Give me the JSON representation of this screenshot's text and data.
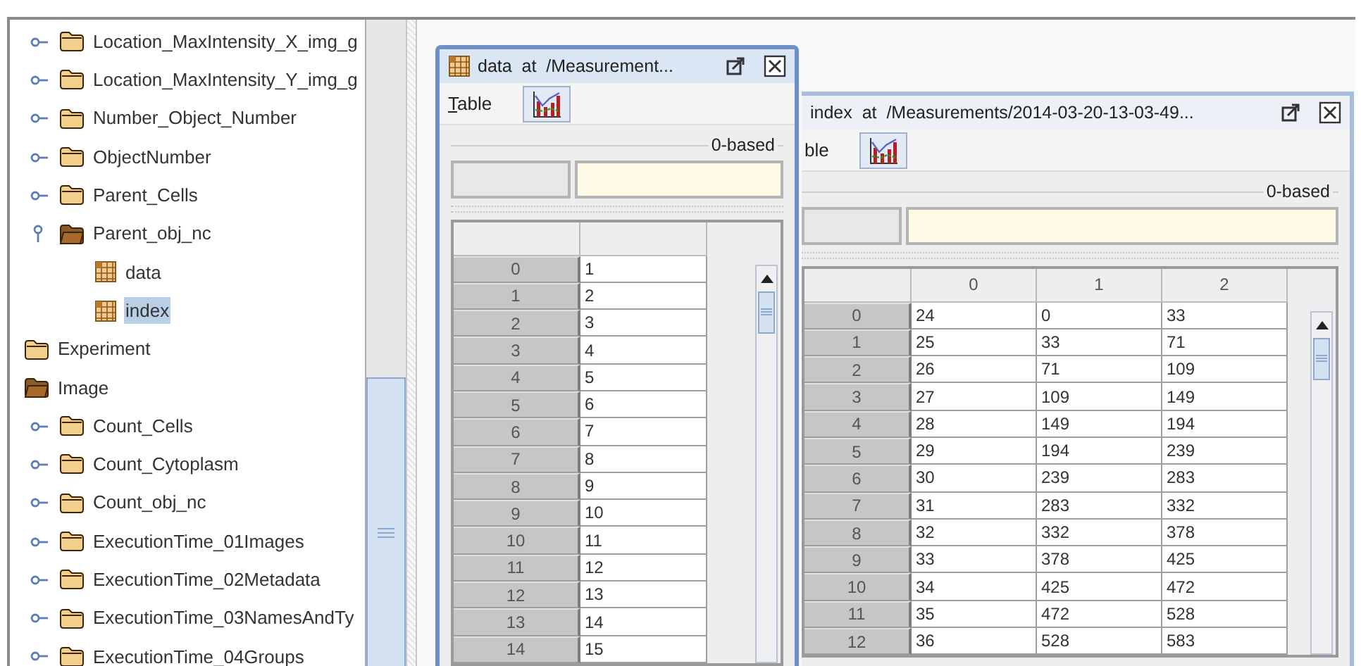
{
  "tree": {
    "items": [
      {
        "children": [
          {
            "label": "Location_MaxIntensity_X_img_g",
            "kind": "group",
            "expanded": false
          },
          {
            "label": "Location_MaxIntensity_Y_img_g",
            "kind": "group",
            "expanded": false
          },
          {
            "label": "Number_Object_Number",
            "kind": "group",
            "expanded": false
          },
          {
            "label": "ObjectNumber",
            "kind": "group",
            "expanded": false
          },
          {
            "label": "Parent_Cells",
            "kind": "group",
            "expanded": false
          },
          {
            "label": "Parent_obj_nc",
            "kind": "group",
            "expanded": true,
            "children": [
              {
                "label": "data",
                "kind": "dataset",
                "selected": false
              },
              {
                "label": "index",
                "kind": "dataset",
                "selected": true
              }
            ]
          }
        ]
      },
      {
        "label": "Experiment",
        "kind": "group",
        "expanded": false
      },
      {
        "label": "Image",
        "kind": "group",
        "expanded": true,
        "children": [
          {
            "label": "Count_Cells",
            "kind": "group",
            "expanded": false
          },
          {
            "label": "Count_Cytoplasm",
            "kind": "group",
            "expanded": false
          },
          {
            "label": "Count_obj_nc",
            "kind": "group",
            "expanded": false
          },
          {
            "label": "ExecutionTime_01Images",
            "kind": "group",
            "expanded": false
          },
          {
            "label": "ExecutionTime_02Metadata",
            "kind": "group",
            "expanded": false
          },
          {
            "label": "ExecutionTime_03NamesAndTy",
            "kind": "group",
            "expanded": false
          },
          {
            "label": "ExecutionTime_04Groups",
            "kind": "group",
            "expanded": false
          }
        ]
      }
    ]
  },
  "windows": [
    {
      "title": "data  at  /Measurement...",
      "active": true,
      "menu": "Table",
      "base_label": "0-based",
      "rows": [
        {
          "header": "0",
          "cells": [
            "1"
          ]
        },
        {
          "header": "1",
          "cells": [
            "2"
          ]
        },
        {
          "header": "2",
          "cells": [
            "3"
          ]
        },
        {
          "header": "3",
          "cells": [
            "4"
          ]
        },
        {
          "header": "4",
          "cells": [
            "5"
          ]
        },
        {
          "header": "5",
          "cells": [
            "6"
          ]
        },
        {
          "header": "6",
          "cells": [
            "7"
          ]
        },
        {
          "header": "7",
          "cells": [
            "8"
          ]
        },
        {
          "header": "8",
          "cells": [
            "9"
          ]
        },
        {
          "header": "9",
          "cells": [
            "10"
          ]
        },
        {
          "header": "10",
          "cells": [
            "11"
          ]
        },
        {
          "header": "11",
          "cells": [
            "12"
          ]
        },
        {
          "header": "12",
          "cells": [
            "13"
          ]
        },
        {
          "header": "13",
          "cells": [
            "14"
          ]
        },
        {
          "header": "14",
          "cells": [
            "15"
          ]
        }
      ]
    },
    {
      "title": "index  at  /Measurements/2014-03-20-13-03-49...",
      "active": false,
      "menu": "ble",
      "base_label": "0-based",
      "columns": [
        "0",
        "1",
        "2"
      ],
      "rows": [
        {
          "header": "0",
          "cells": [
            "24",
            "0",
            "33"
          ]
        },
        {
          "header": "1",
          "cells": [
            "25",
            "33",
            "71"
          ]
        },
        {
          "header": "2",
          "cells": [
            "26",
            "71",
            "109"
          ]
        },
        {
          "header": "3",
          "cells": [
            "27",
            "109",
            "149"
          ]
        },
        {
          "header": "4",
          "cells": [
            "28",
            "149",
            "194"
          ]
        },
        {
          "header": "5",
          "cells": [
            "29",
            "194",
            "239"
          ]
        },
        {
          "header": "6",
          "cells": [
            "30",
            "239",
            "283"
          ]
        },
        {
          "header": "7",
          "cells": [
            "31",
            "283",
            "332"
          ]
        },
        {
          "header": "8",
          "cells": [
            "32",
            "332",
            "378"
          ]
        },
        {
          "header": "9",
          "cells": [
            "33",
            "378",
            "425"
          ]
        },
        {
          "header": "10",
          "cells": [
            "34",
            "425",
            "472"
          ]
        },
        {
          "header": "11",
          "cells": [
            "35",
            "472",
            "528"
          ]
        },
        {
          "header": "12",
          "cells": [
            "36",
            "528",
            "583"
          ]
        }
      ]
    }
  ]
}
